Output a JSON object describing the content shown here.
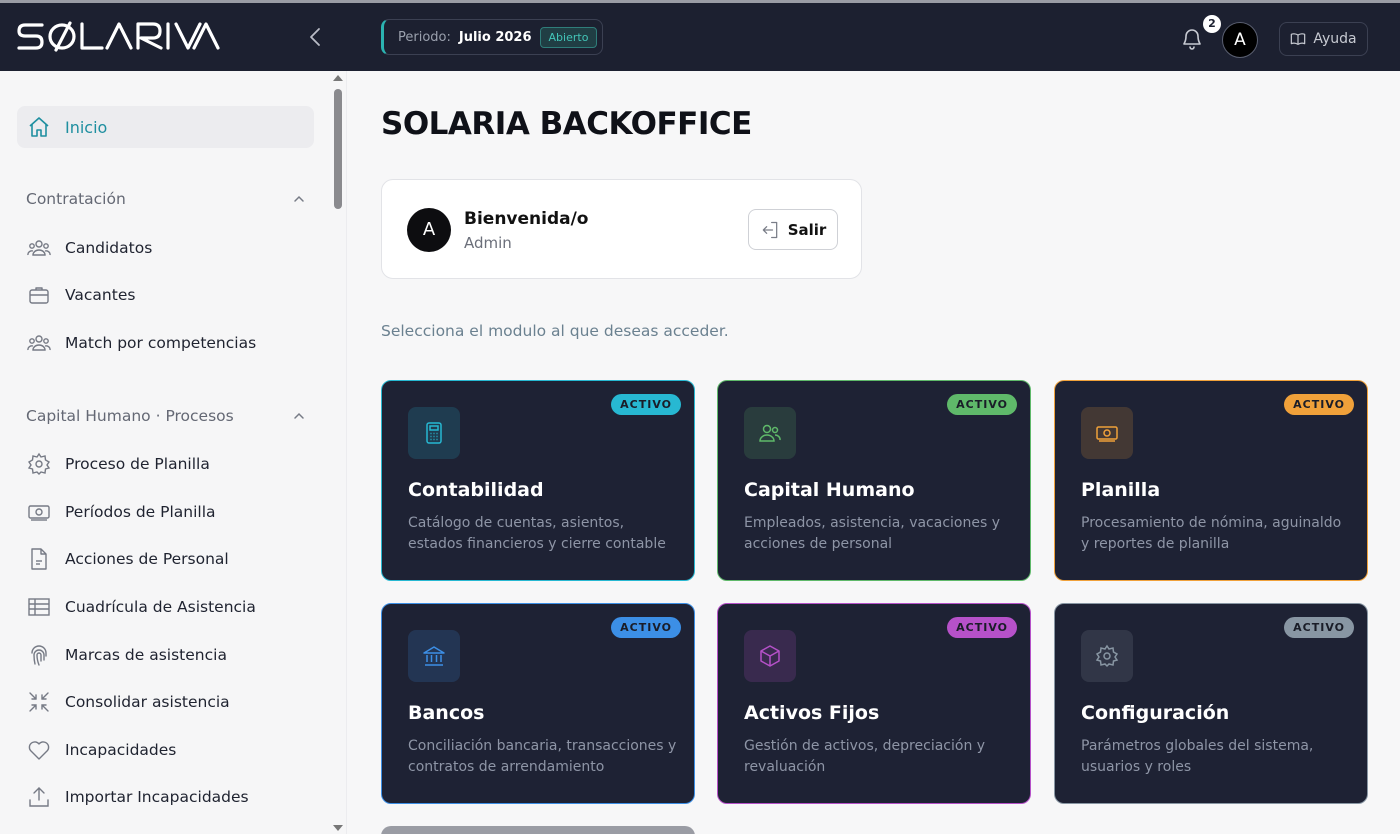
{
  "header": {
    "logo_text": "SOLARIA",
    "period_label": "Periodo:",
    "period_value": "Julio 2026",
    "period_status": "Abierto",
    "notifications_count": "2",
    "avatar_initial": "A",
    "help_label": "Ayuda"
  },
  "sidebar": {
    "home": "Inicio",
    "sections": [
      {
        "title": "Contratación",
        "items": [
          "Candidatos",
          "Vacantes",
          "Match por competencias"
        ]
      },
      {
        "title": "Capital Humano · Procesos",
        "items": [
          "Proceso de Planilla",
          "Períodos de Planilla",
          "Acciones de Personal",
          "Cuadrícula de Asistencia",
          "Marcas de asistencia",
          "Consolidar asistencia",
          "Incapacidades",
          "Importar Incapacidades"
        ]
      }
    ]
  },
  "main": {
    "title": "SOLARIA BACKOFFICE",
    "welcome": {
      "avatar_initial": "A",
      "title": "Bienvenida/o",
      "subtitle": "Admin",
      "logout_label": "Salir"
    },
    "instruction": "Selecciona el modulo al que deseas acceder.",
    "modules": [
      {
        "title": "Contabilidad",
        "description": "Catálogo de cuentas, asientos, estados financieros y cierre contable",
        "badge": "ACTIVO",
        "icon": "calculator-icon",
        "color": "#27b8d2"
      },
      {
        "title": "Capital Humano",
        "description": "Empleados, asistencia, vacaciones y acciones de personal",
        "badge": "ACTIVO",
        "icon": "users-icon",
        "color": "#5fb96a"
      },
      {
        "title": "Planilla",
        "description": "Procesamiento de nómina, aguinaldo y reportes de planilla",
        "badge": "ACTIVO",
        "icon": "money-icon",
        "color": "#f0a13a"
      },
      {
        "title": "Bancos",
        "description": "Conciliación bancaria, transacciones y contratos de arrendamiento",
        "badge": "ACTIVO",
        "icon": "bank-icon",
        "color": "#3c8fe6"
      },
      {
        "title": "Activos Fijos",
        "description": "Gestión de activos, depreciación y revaluación",
        "badge": "ACTIVO",
        "icon": "cube-icon",
        "color": "#b651c9"
      },
      {
        "title": "Configuración",
        "description": "Parámetros globales del sistema, usuarios y roles",
        "badge": "ACTIVO",
        "icon": "gear-icon",
        "color": "#8896a3"
      }
    ]
  }
}
